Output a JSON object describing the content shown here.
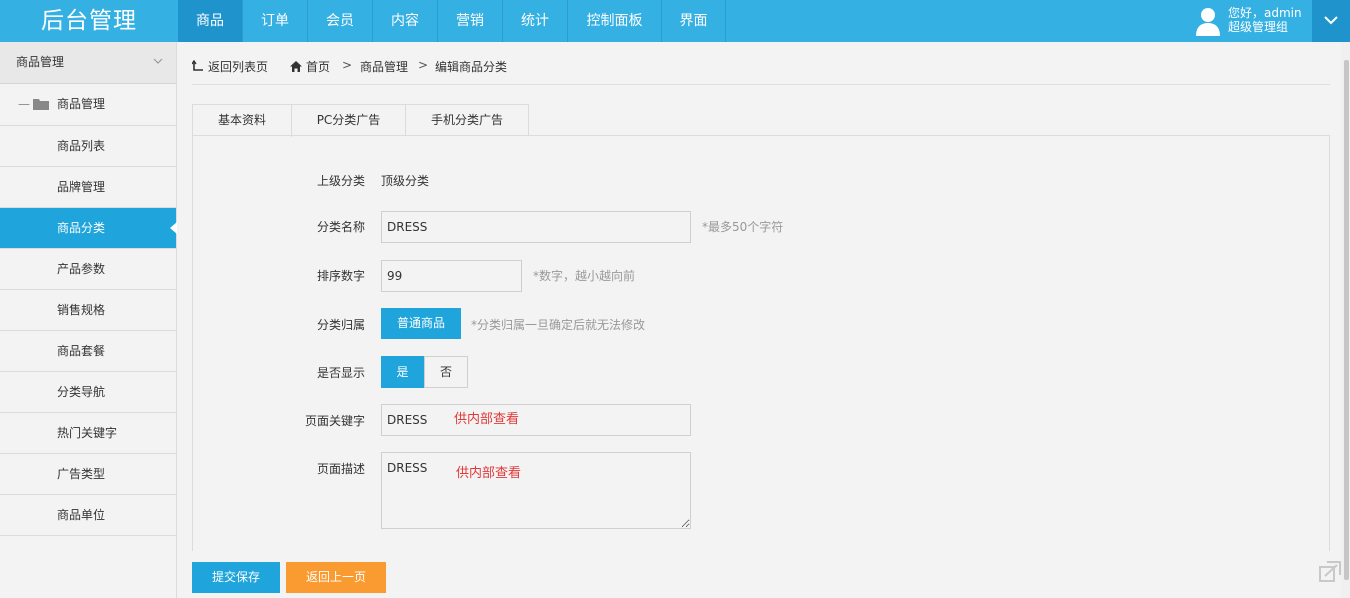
{
  "header": {
    "logo": "后台管理",
    "nav": [
      {
        "label": "商品",
        "active": true
      },
      {
        "label": "订单"
      },
      {
        "label": "会员"
      },
      {
        "label": "内容"
      },
      {
        "label": "营销"
      },
      {
        "label": "统计"
      },
      {
        "label": "控制面板"
      },
      {
        "label": "界面"
      }
    ],
    "user_greeting": "您好，admin",
    "user_role": "超级管理组"
  },
  "sidebar": {
    "title": "商品管理",
    "group": "商品管理",
    "items": [
      "商品列表",
      "品牌管理",
      "商品分类",
      "产品参数",
      "销售规格",
      "商品套餐",
      "分类导航",
      "热门关键字",
      "广告类型",
      "商品单位"
    ],
    "active_index": 2
  },
  "breadcrumb": {
    "back": "返回列表页",
    "home": "首页",
    "level1": "商品管理",
    "current": "编辑商品分类"
  },
  "tabs": [
    "基本资料",
    "PC分类广告",
    "手机分类广告"
  ],
  "form": {
    "parent_label": "上级分类",
    "parent_value": "顶级分类",
    "name_label": "分类名称",
    "name_value": "DRESS",
    "name_hint": "*最多50个字符",
    "sort_label": "排序数字",
    "sort_value": "99",
    "sort_hint": "*数字，越小越向前",
    "type_label": "分类归属",
    "type_button": "普通商品",
    "type_hint": "*分类归属一旦确定后就无法修改",
    "show_label": "是否显示",
    "show_yes": "是",
    "show_no": "否",
    "keywords_label": "页面关键字",
    "keywords_value": "DRESS",
    "keywords_note": "供内部查看",
    "desc_label": "页面描述",
    "desc_value": "DRESS",
    "desc_note": "供内部查看"
  },
  "actions": {
    "submit": "提交保存",
    "back": "返回上一页"
  },
  "colors": {
    "primary": "#35b0e3",
    "active": "#1fa4db",
    "orange": "#f99b31",
    "note_red": "#e03a3a"
  }
}
